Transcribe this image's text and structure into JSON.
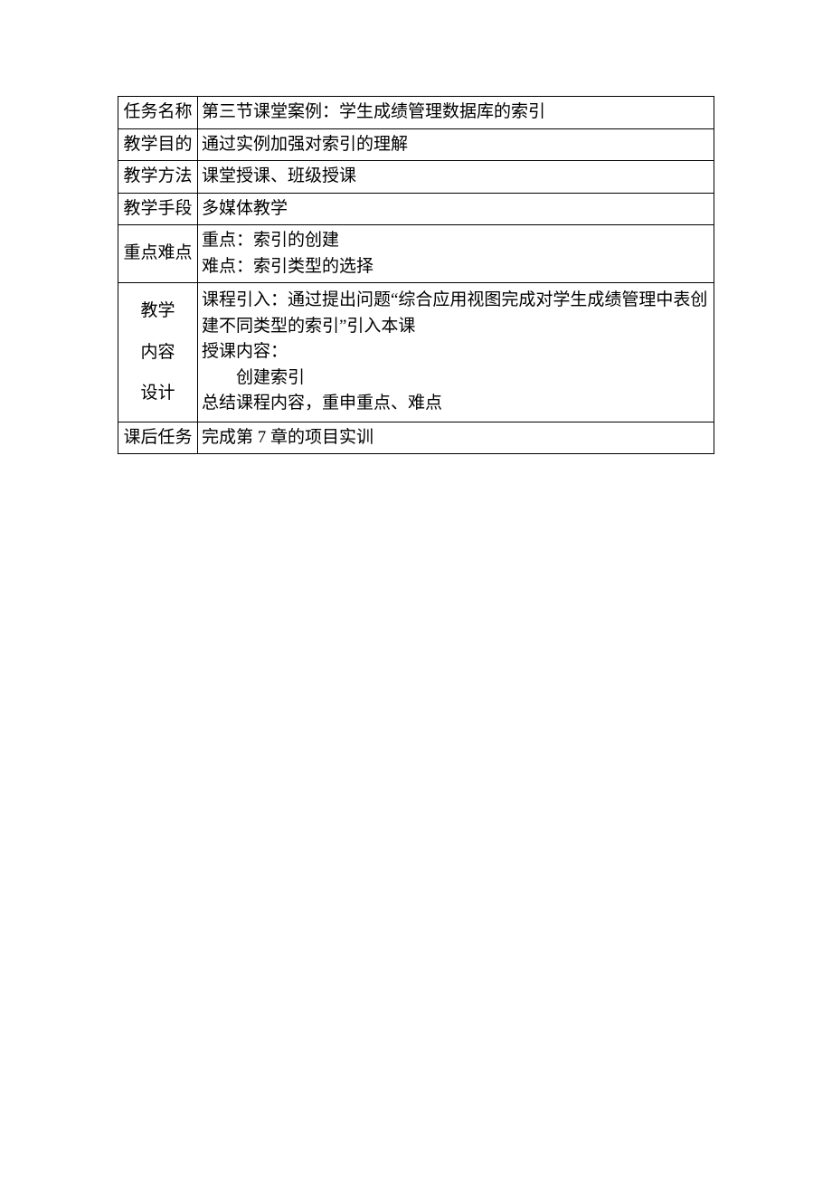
{
  "rows": {
    "r1": {
      "label": "任务名称",
      "value": "第三节课堂案例：学生成绩管理数据库的索引"
    },
    "r2": {
      "label": "教学目的",
      "value": "通过实例加强对索引的理解"
    },
    "r3": {
      "label": "教学方法",
      "value": "课堂授课、班级授课"
    },
    "r4": {
      "label": "教学手段",
      "value": "多媒体教学"
    },
    "r5": {
      "label": "重点难点",
      "line1": "重点：索引的创建",
      "line2": "难点：索引类型的选择"
    },
    "r6": {
      "label1": "教学",
      "label2": "内容",
      "label3": "设计",
      "line1": "课程引入：通过提出问题“综合应用视图完成对学生成绩管理中表创建不同类型的索引”引入本课",
      "line2": "授课内容：",
      "line2sub": "创建索引",
      "line3": "总结课程内容，重申重点、难点"
    },
    "r7": {
      "label": "课后任务",
      "value": "完成第 7 章的项目实训"
    }
  }
}
